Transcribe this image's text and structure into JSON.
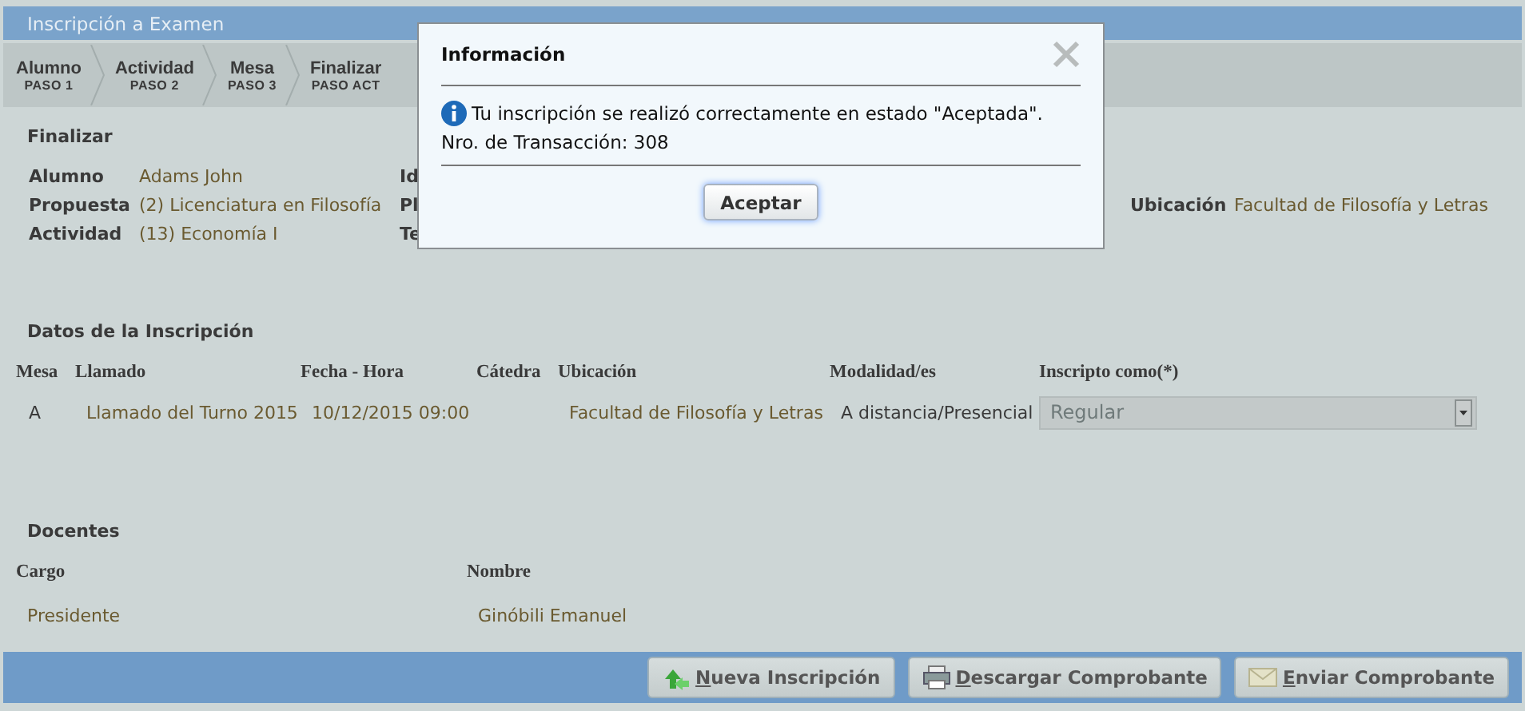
{
  "page": {
    "title": "Inscripción a Examen"
  },
  "steps": [
    {
      "label": "Alumno",
      "sub": "PASO 1"
    },
    {
      "label": "Actividad",
      "sub": "PASO 2"
    },
    {
      "label": "Mesa",
      "sub": "PASO 3"
    },
    {
      "label": "Finalizar",
      "sub": "PASO ACT"
    }
  ],
  "summary": {
    "title": "Finalizar",
    "rows": [
      {
        "items": [
          {
            "label": "Alumno",
            "value": "Adams John"
          },
          {
            "label": "Id"
          }
        ]
      },
      {
        "items": [
          {
            "label": "Propuesta",
            "value": "(2) Licenciatura en Filosofía"
          },
          {
            "label": "Pl"
          },
          {
            "label": "Ubicación",
            "value": "Facultad de Filosofía y Letras"
          }
        ]
      },
      {
        "items": [
          {
            "label": "Actividad",
            "value": "(13) Economía I"
          },
          {
            "label": "Te"
          }
        ]
      }
    ]
  },
  "inscription": {
    "title": "Datos de la Inscripción",
    "columns": [
      "Mesa",
      "Llamado",
      "Fecha - Hora",
      "Cátedra",
      "Ubicación",
      "Modalidad/es",
      "Inscripto como(*)"
    ],
    "rows": [
      {
        "cells": [
          "A",
          "Llamado del Turno 2015",
          "10/12/2015 09:00",
          null,
          "Facultad de Filosofía y Letras",
          "A distancia/Presencial"
        ],
        "inscripto": {
          "value": "Regular",
          "disabled": true
        }
      }
    ]
  },
  "teachers": {
    "title": "Docentes",
    "columns": [
      "Cargo",
      "Nombre"
    ],
    "rows": [
      [
        "Presidente",
        "Ginóbili Emanuel"
      ]
    ]
  },
  "buttons": [
    {
      "label": "Nueva Inscripción",
      "kind": "new"
    },
    {
      "label": "Descargar Comprobante",
      "kind": "download"
    },
    {
      "label": "Enviar Comprobante",
      "kind": "send"
    }
  ],
  "dialog": {
    "title": "Información",
    "message": "Tu inscripción se realizó correctamente en estado \"Aceptada\".",
    "detail": "Nro. de Transacción: 308",
    "button": "Aceptar"
  }
}
